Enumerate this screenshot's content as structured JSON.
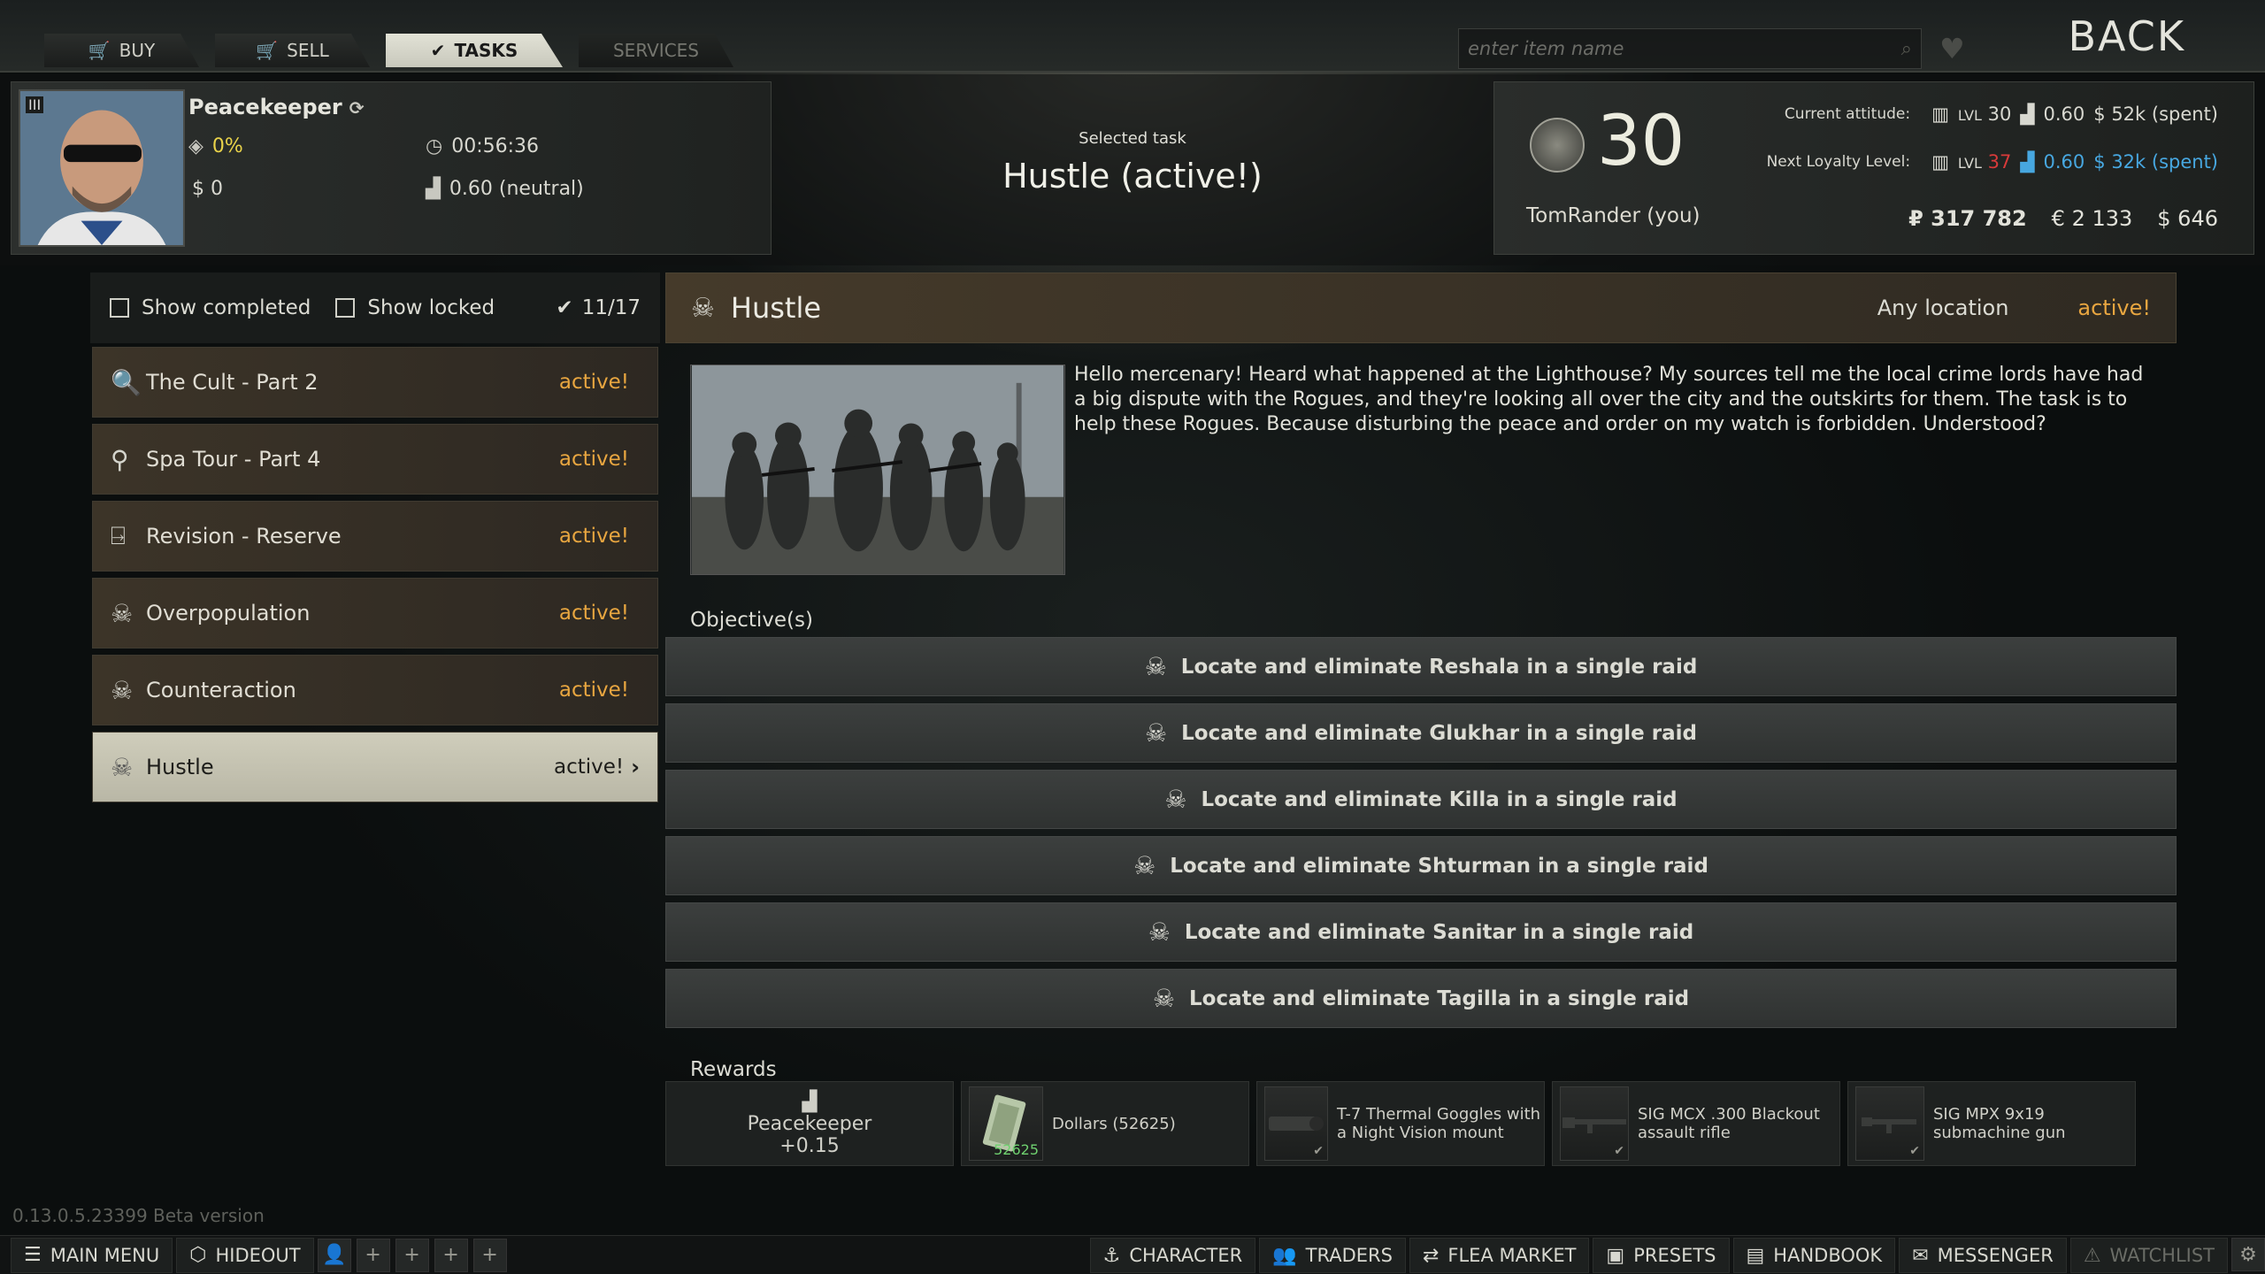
{
  "nav": {
    "tabs": [
      {
        "label": "BUY",
        "icon": "cart-icon"
      },
      {
        "label": "SELL",
        "icon": "cart-icon"
      },
      {
        "label": "TASKS",
        "icon": "check-circle-icon"
      },
      {
        "label": "SERVICES",
        "icon": ""
      }
    ],
    "search_placeholder": "enter item name",
    "back_label": "BACK"
  },
  "trader": {
    "rank_badge": "III",
    "name": "Peacekeeper",
    "percent": "0%",
    "timer": "00:56:36",
    "dollars": "$ 0",
    "standing": "0.60 (neutral)"
  },
  "selected_task": {
    "label": "Selected task",
    "title": "Hustle (active!)"
  },
  "player": {
    "level": "30",
    "name": "TomRander (you)",
    "current_attitude_label": "Current attitude:",
    "current_lvl_prefix": "LVL",
    "current_lvl": "30",
    "current_standing": "0.60",
    "current_spent": "$ 52k (spent)",
    "next_label": "Next Loyalty Level:",
    "next_lvl_prefix": "LVL",
    "next_lvl": "37",
    "next_standing": "0.60",
    "next_spent": "$ 32k (spent)",
    "roubles": "₽ 317 782",
    "euros": "€ 2 133",
    "usd": "$ 646"
  },
  "filters": {
    "show_completed": "Show completed",
    "show_locked": "Show locked",
    "count": "11/17"
  },
  "tasks": [
    {
      "title": "The Cult - Part 2",
      "status": "active!",
      "icon": "magnifier-icon"
    },
    {
      "title": "Spa Tour - Part 4",
      "status": "active!",
      "icon": "location-pin-icon"
    },
    {
      "title": "Revision - Reserve",
      "status": "active!",
      "icon": "exit-icon"
    },
    {
      "title": "Overpopulation",
      "status": "active!",
      "icon": "skull-icon"
    },
    {
      "title": "Counteraction",
      "status": "active!",
      "icon": "skull-icon"
    },
    {
      "title": "Hustle",
      "status": "active!",
      "icon": "skull-icon"
    }
  ],
  "detail": {
    "name": "Hustle",
    "location": "Any location",
    "status": "active!",
    "description": "Hello mercenary! Heard what happened at the Lighthouse? My sources tell me the local crime lords have had a big dispute with the Rogues, and they're looking all over the city and the outskirts for them. The task is to help these Rogues. Because disturbing the peace and order on my watch is forbidden. Understood?",
    "objectives_label": "Objective(s)",
    "objectives": [
      "Locate and eliminate Reshala in a single raid",
      "Locate and eliminate Glukhar in a single raid",
      "Locate and eliminate Killa in a single raid",
      "Locate and eliminate Shturman in a single raid",
      "Locate and eliminate Sanitar in a single raid",
      "Locate and eliminate Tagilla in a single raid"
    ],
    "rewards_label": "Rewards",
    "rewards": {
      "standing_trader": "Peacekeeper",
      "standing_value": "+0.15",
      "cash_label": "Dollars (52625)",
      "cash_tag": "52625",
      "item1": "T-7 Thermal Goggles with a Night Vision mount",
      "item2": "SIG MCX .300 Blackout assault rifle",
      "item3": "SIG MPX 9x19 submachine gun"
    }
  },
  "version": "0.13.0.5.23399 Beta version",
  "bottom": {
    "main_menu": "MAIN MENU",
    "hideout": "HIDEOUT",
    "character": "CHARACTER",
    "traders": "TRADERS",
    "flea_market": "FLEA MARKET",
    "presets": "PRESETS",
    "handbook": "HANDBOOK",
    "messenger": "MESSENGER",
    "watchlist": "WATCHLIST"
  },
  "colors": {
    "accent_orange": "#e8a640",
    "level_red": "#d83a3a",
    "next_blue": "#47a7e0",
    "yellow": "#e9d34a"
  }
}
